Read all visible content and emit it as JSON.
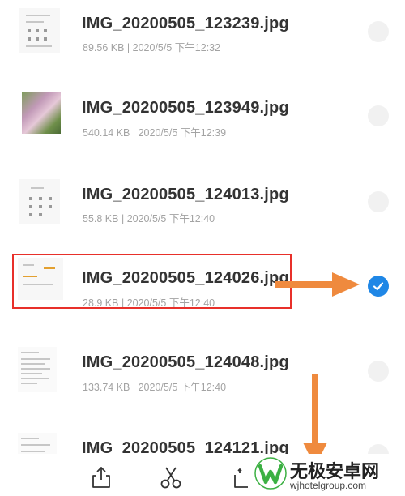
{
  "files": [
    {
      "name": "IMG_20200505_123239.jpg",
      "size": "89.56 KB",
      "date": "2020/5/5 下午12:32",
      "selected": false,
      "thumb": "screenshot"
    },
    {
      "name": "IMG_20200505_123949.jpg",
      "size": "540.14 KB",
      "date": "2020/5/5 下午12:39",
      "selected": false,
      "thumb": "photo"
    },
    {
      "name": "IMG_20200505_124013.jpg",
      "size": "55.8 KB",
      "date": "2020/5/5 下午12:40",
      "selected": false,
      "thumb": "screenshot"
    },
    {
      "name": "IMG_20200505_124026.jpg",
      "size": "28.9 KB",
      "date": "2020/5/5 下午12:40",
      "selected": true,
      "thumb": "screenshot"
    },
    {
      "name": "IMG_20200505_124048.jpg",
      "size": "133.74 KB",
      "date": "2020/5/5 下午12:40",
      "selected": false,
      "thumb": "document"
    },
    {
      "name": "IMG_20200505_124121.jpg",
      "size": "",
      "date": "",
      "selected": false,
      "thumb": "document"
    }
  ],
  "meta_separator": "|",
  "toolbar": {
    "icons": [
      "share-icon",
      "cut-icon",
      "copy-icon"
    ]
  },
  "annotation": {
    "highlight_color": "#e8302a",
    "arrow_color": "#ef8a3e"
  },
  "watermark": {
    "title": "无极安卓网",
    "url": "wjhotelgroup.com",
    "logo_color": "#3cb043"
  },
  "colors": {
    "checked": "#1f87e6",
    "unchecked": "#f1f1f1",
    "filename": "#333333",
    "meta": "#a3a3a3"
  }
}
